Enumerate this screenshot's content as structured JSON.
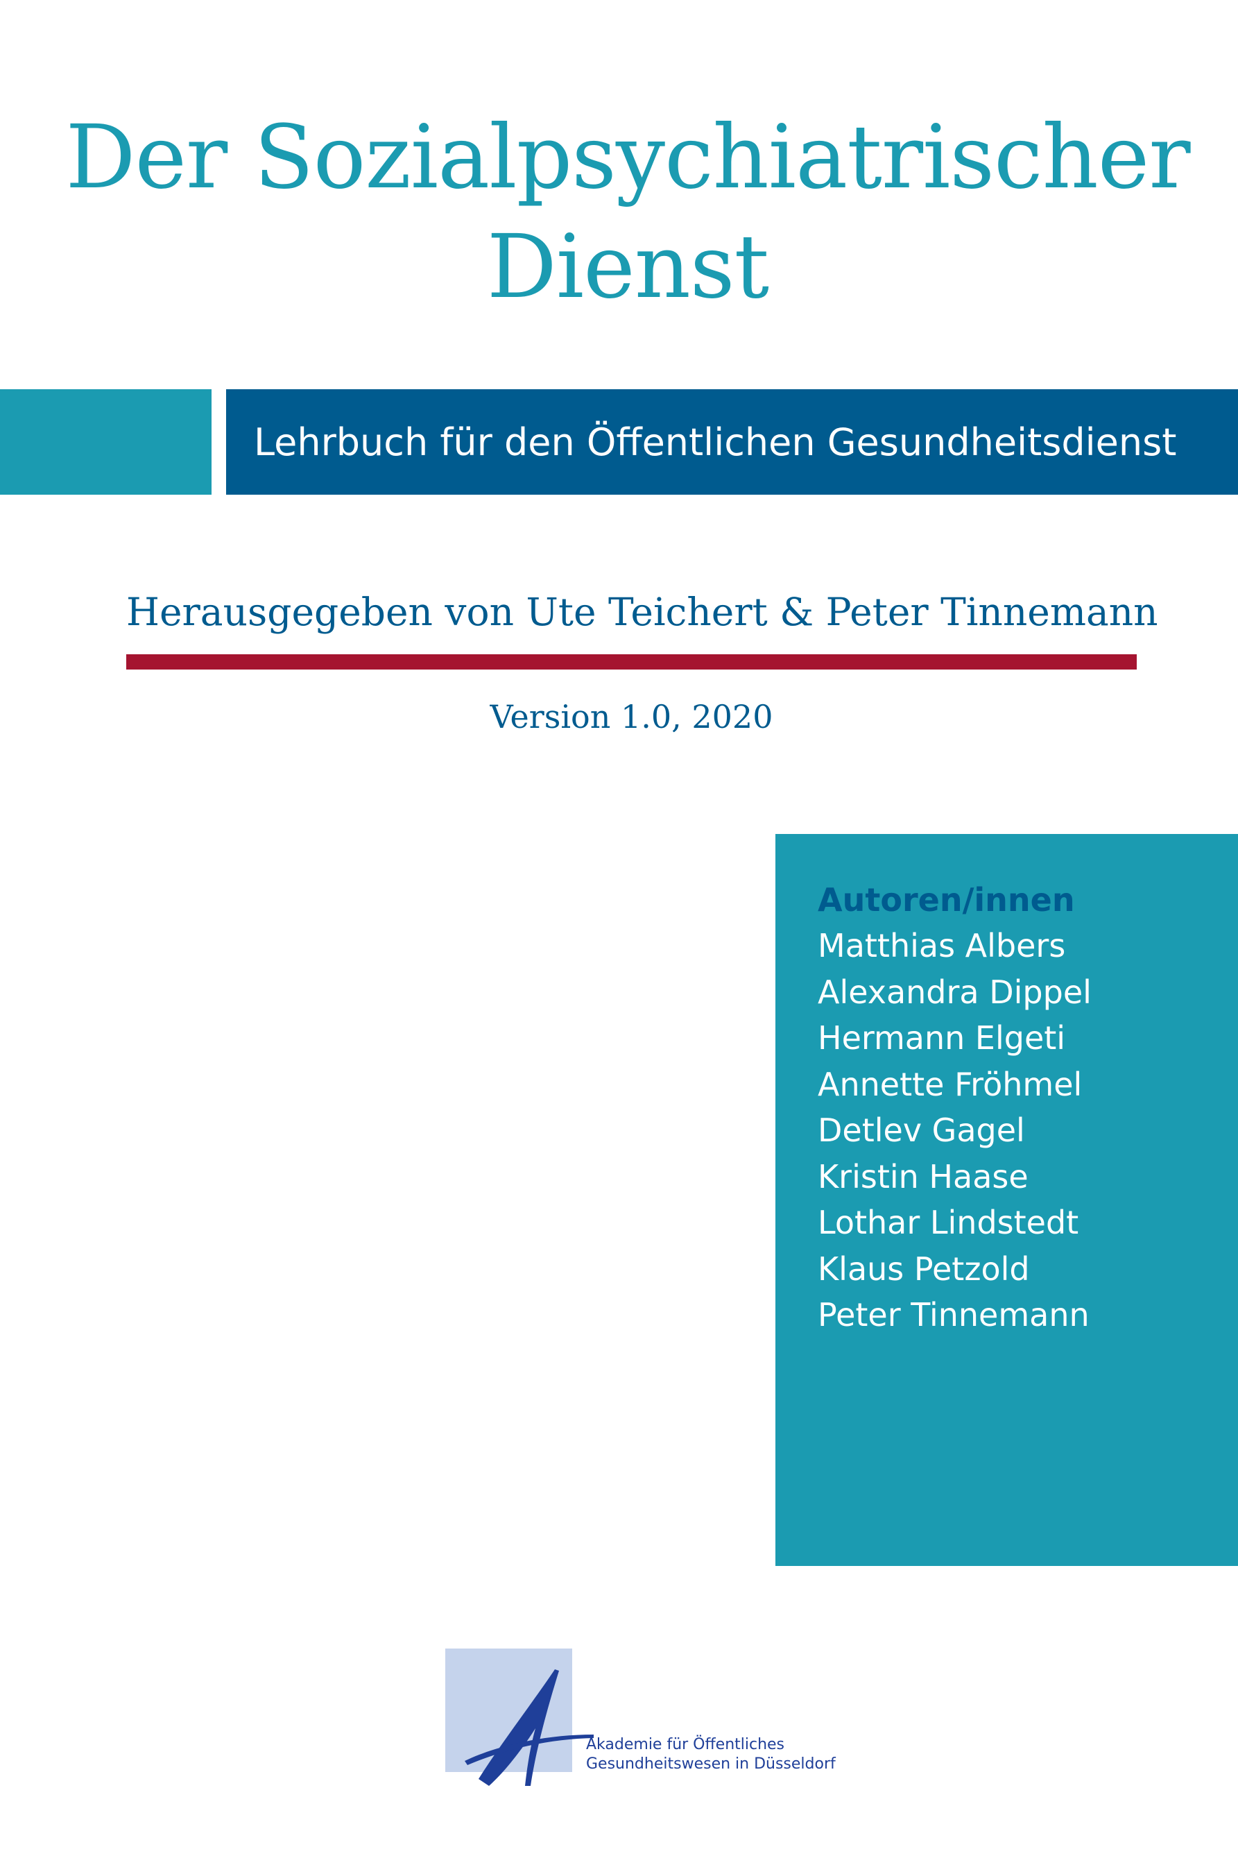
{
  "cover": {
    "title_line1": "Der Sozialpsychiatrischer",
    "title_line2": "Dienst",
    "subtitle": "Lehrbuch für den Öffentlichen Gesundheitsdienst",
    "editors": "Herausgegeben von Ute Teichert & Peter Tinnemann",
    "version": "Version 1.0, 2020"
  },
  "authors": {
    "heading": "Autoren/innen",
    "names": [
      "Matthias Albers",
      "Alexandra Dippel",
      "Hermann Elgeti",
      "Annette Fröhmel",
      "Detlev Gagel",
      "Kristin Haase",
      "Lothar Lindstedt",
      "Klaus Petzold",
      "Peter Tinnemann"
    ]
  },
  "publisher": {
    "line1": "Akademie für Öffentliches",
    "line2": "Gesundheitswesen in Düsseldorf",
    "logo_icon": "akademie-a-logo-icon"
  },
  "colors": {
    "teal": "#1b9bb1",
    "blue": "#005b8f",
    "red": "#a51430",
    "logo_bg": "#c5d3ec",
    "logo_ink": "#1f3f99"
  }
}
